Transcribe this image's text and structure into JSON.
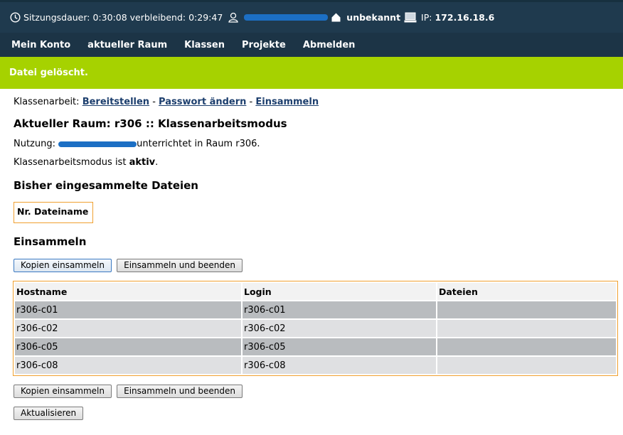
{
  "status": {
    "session_label": "Sitzungsdauer: 0:30:08 verbleibend: 0:29:47",
    "user_status": "unbekannt",
    "ip_label": "IP:",
    "ip_value": "172.16.18.6"
  },
  "nav": {
    "items": [
      "Mein Konto",
      "aktueller Raum",
      "Klassen",
      "Projekte",
      "Abmelden"
    ]
  },
  "message": "Datei gelöscht.",
  "exam": {
    "prefix": "Klassenarbeit:",
    "links": [
      "Bereitstellen",
      "Passwort ändern",
      "Einsammeln"
    ],
    "separator": " - ",
    "heading": "Aktueller Raum: r306 :: Klassenarbeitsmodus",
    "usage_prefix": "Nutzung:",
    "usage_suffix": "unterrichtet in Raum r306.",
    "mode_prefix": "Klassenarbeitsmodus ist ",
    "mode_value": "aktiv",
    "mode_suffix": "."
  },
  "collected": {
    "heading": "Bisher eingesammelte Dateien",
    "columns": [
      "Nr.",
      "Dateiname"
    ]
  },
  "collect": {
    "heading": "Einsammeln",
    "copy_button": "Kopien einsammeln",
    "finish_button": "Einsammeln und beenden",
    "refresh_button": "Aktualisieren",
    "columns": [
      "Hostname",
      "Login",
      "Dateien"
    ],
    "rows": [
      {
        "host": "r306-c01",
        "login": "r306-c01",
        "files": ""
      },
      {
        "host": "r306-c02",
        "login": "r306-c02",
        "files": ""
      },
      {
        "host": "r306-c05",
        "login": "r306-c05",
        "files": ""
      },
      {
        "host": "r306-c08",
        "login": "r306-c08",
        "files": ""
      }
    ]
  },
  "colors": {
    "statusbar": "#1f3a4e",
    "navbar": "#1c3446",
    "message": "#a6d200",
    "table_border": "#f0a030",
    "link": "#1d3f6e"
  }
}
